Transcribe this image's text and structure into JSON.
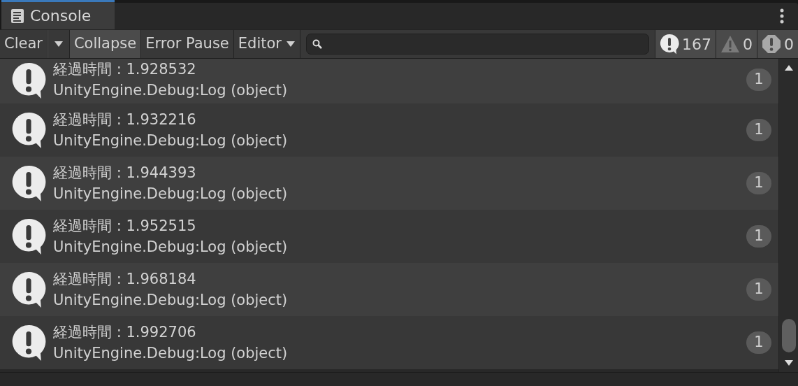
{
  "window": {
    "title": "Console"
  },
  "toolbar": {
    "buttons": [
      {
        "label": "Clear",
        "kind": "split",
        "on": false
      },
      {
        "label": "Collapse",
        "kind": "toggle",
        "on": true
      },
      {
        "label": "Error Pause",
        "kind": "toggle",
        "on": false
      },
      {
        "label": "Editor",
        "kind": "dropdown",
        "on": false
      }
    ],
    "counters": [
      {
        "kind": "log",
        "count": "167"
      },
      {
        "kind": "warning",
        "count": "0"
      },
      {
        "kind": "error",
        "count": "0"
      }
    ]
  },
  "messages": [
    {
      "text": "経過時間 : 1.928532",
      "source": "UnityEngine.Debug:Log (object)",
      "count": "1"
    },
    {
      "text": "経過時間 : 1.932216",
      "source": "UnityEngine.Debug:Log (object)",
      "count": "1"
    },
    {
      "text": "経過時間 : 1.944393",
      "source": "UnityEngine.Debug:Log (object)",
      "count": "1"
    },
    {
      "text": "経過時間 : 1.952515",
      "source": "UnityEngine.Debug:Log (object)",
      "count": "1"
    },
    {
      "text": "経過時間 : 1.968184",
      "source": "UnityEngine.Debug:Log (object)",
      "count": "1"
    },
    {
      "text": "経過時間 : 1.992706",
      "source": "UnityEngine.Debug:Log (object)",
      "count": "1"
    }
  ]
}
